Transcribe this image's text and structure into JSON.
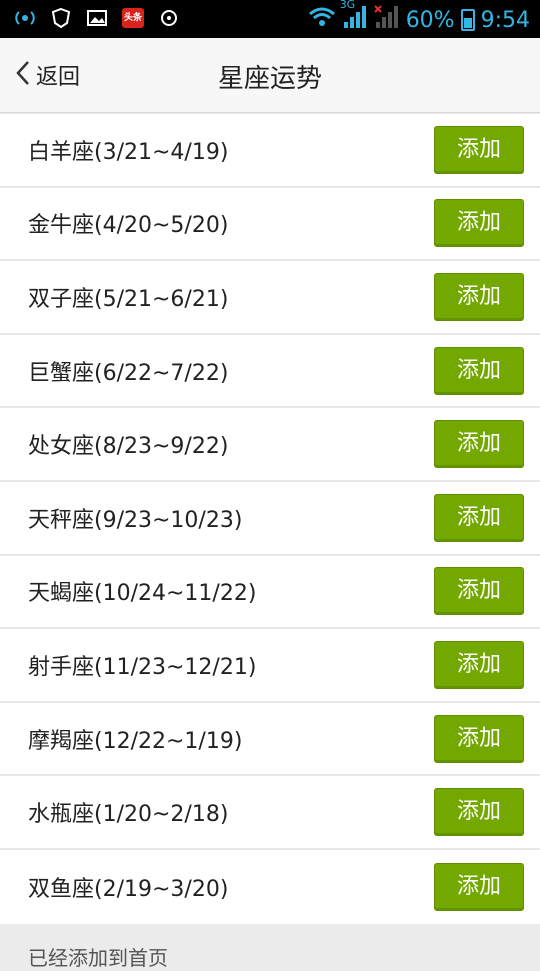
{
  "statusbar": {
    "battery": "60%",
    "time": "9:54",
    "network": "3G",
    "icons": [
      "signal-strength-icon",
      "shield-icon",
      "image-icon",
      "news-app-icon",
      "sync-icon",
      "wifi-icon",
      "cell-signal-icon",
      "no-signal-icon",
      "battery-icon"
    ],
    "news_label": "头条"
  },
  "header": {
    "back_label": "返回",
    "title": "星座运势"
  },
  "signs": [
    {
      "label": "白羊座(3/21~4/19)",
      "button": "添加"
    },
    {
      "label": "金牛座(4/20~5/20)",
      "button": "添加"
    },
    {
      "label": "双子座(5/21~6/21)",
      "button": "添加"
    },
    {
      "label": "巨蟹座(6/22~7/22)",
      "button": "添加"
    },
    {
      "label": "处女座(8/23~9/22)",
      "button": "添加"
    },
    {
      "label": "天秤座(9/23~10/23)",
      "button": "添加"
    },
    {
      "label": "天蝎座(10/24~11/22)",
      "button": "添加"
    },
    {
      "label": "射手座(11/23~12/21)",
      "button": "添加"
    },
    {
      "label": "摩羯座(12/22~1/19)",
      "button": "添加"
    },
    {
      "label": "水瓶座(1/20~2/18)",
      "button": "添加"
    },
    {
      "label": "双鱼座(2/19~3/20)",
      "button": "添加"
    }
  ],
  "footer": {
    "note": "已经添加到首页"
  },
  "colors": {
    "button_green": "#73a800",
    "status_blue": "#33b5e5"
  }
}
